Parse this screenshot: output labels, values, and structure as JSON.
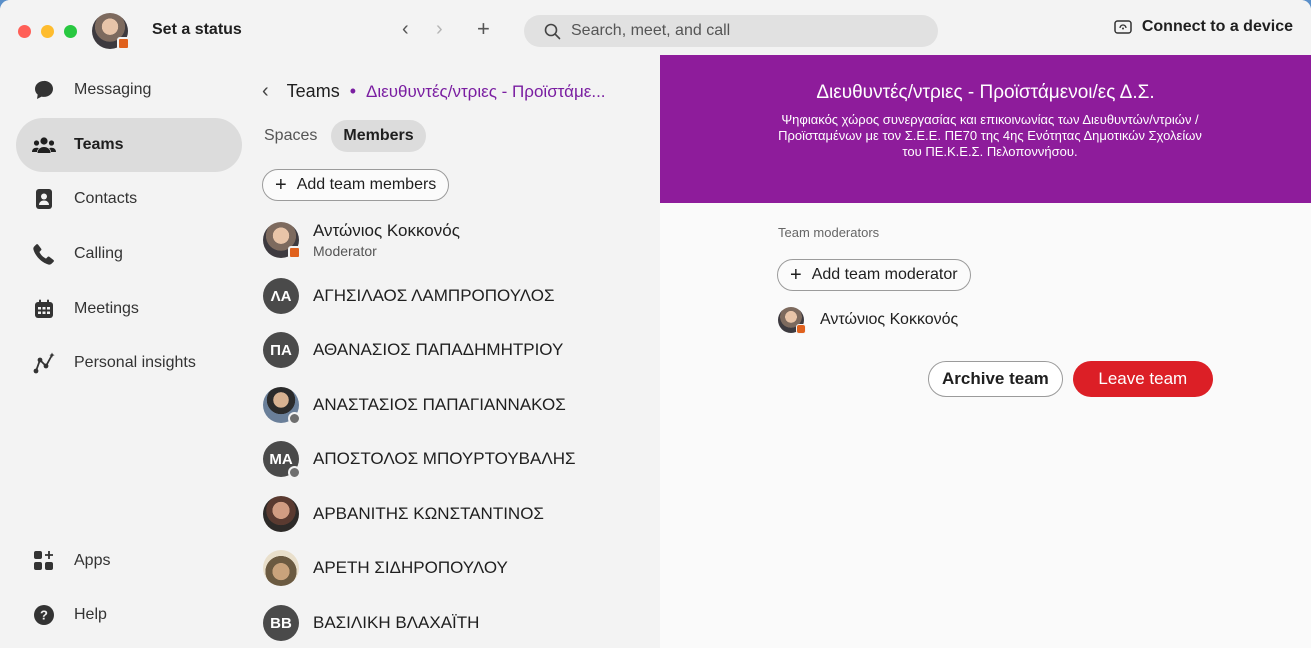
{
  "titlebar": {
    "status_label": "Set a status",
    "search_placeholder": "Search, meet, and call",
    "connect_label": "Connect to a device"
  },
  "nav": {
    "items": [
      {
        "label": "Messaging",
        "icon": "chat-bubble-icon"
      },
      {
        "label": "Teams",
        "icon": "people-icon",
        "active": true
      },
      {
        "label": "Contacts",
        "icon": "contact-book-icon"
      },
      {
        "label": "Calling",
        "icon": "phone-icon"
      },
      {
        "label": "Meetings",
        "icon": "calendar-icon"
      },
      {
        "label": "Personal insights",
        "icon": "insights-icon"
      },
      {
        "label": "Apps",
        "icon": "apps-grid-icon"
      },
      {
        "label": "Help",
        "icon": "help-icon"
      }
    ]
  },
  "members_pane": {
    "breadcrumb_root": "Teams",
    "breadcrumb_sep": "•",
    "team_name_short": "Διευθυντές/ντριες - Προϊστάμε...",
    "tabs": [
      "Spaces",
      "Members"
    ],
    "selected_tab": "Members",
    "add_members_label": "Add team members",
    "members": [
      {
        "name": "Αντώνιος Κοκκονός",
        "role": "Moderator",
        "avatar": "photo"
      },
      {
        "name": "ΑΓΗΣΙΛΑΟΣ ΛΑΜΠΡΟΠΟΥΛΟΣ",
        "initials": "ΛΑ"
      },
      {
        "name": "ΑΘΑΝΑΣΙΟΣ ΠΑΠΑΔΗΜΗΤΡΙΟΥ",
        "initials": "ΠΑ"
      },
      {
        "name": "ΑΝΑΣΤΑΣΙΟΣ ΠΑΠΑΓΙΑΝΝΑΚΟΣ",
        "avatar": "photo"
      },
      {
        "name": "ΑΠΟΣΤΟΛΟΣ ΜΠΟΥΡΤΟΥΒΑΛΗΣ",
        "initials": "ΜΑ"
      },
      {
        "name": "ΑΡΒΑΝΙΤΗΣ ΚΩΝΣΤΑΝΤΙΝΟΣ",
        "avatar": "photo"
      },
      {
        "name": "ΑΡΕΤΗ ΣΙΔΗΡΟΠΟΥΛΟΥ",
        "avatar": "photo"
      },
      {
        "name": "ΒΑΣΙΛΙΚΗ ΒΛΑΧΑΪΤΗ",
        "initials": "ΒΒ"
      }
    ]
  },
  "detail": {
    "title": "Διευθυντές/ντριες - Προϊστάμενοι/ες Δ.Σ.",
    "description": "Ψηφιακός χώρος συνεργασίας και επικοινωνίας των Διευθυντών/ντριών / Προϊσταμένων με τον Σ.Ε.Ε. ΠΕ70 της 4ης Ενότητας Δημοτικών Σχολείων του ΠΕ.Κ.Ε.Σ. Πελοποννήσου.",
    "moderators_label": "Team moderators",
    "add_moderator_label": "Add team moderator",
    "moderator_name": "Αντώνιος Κοκκονός",
    "archive_label": "Archive team",
    "leave_label": "Leave team"
  },
  "colors": {
    "banner": "#8e1c9b",
    "leave_button": "#dc1f26",
    "accent_text": "#7a1ea1"
  }
}
